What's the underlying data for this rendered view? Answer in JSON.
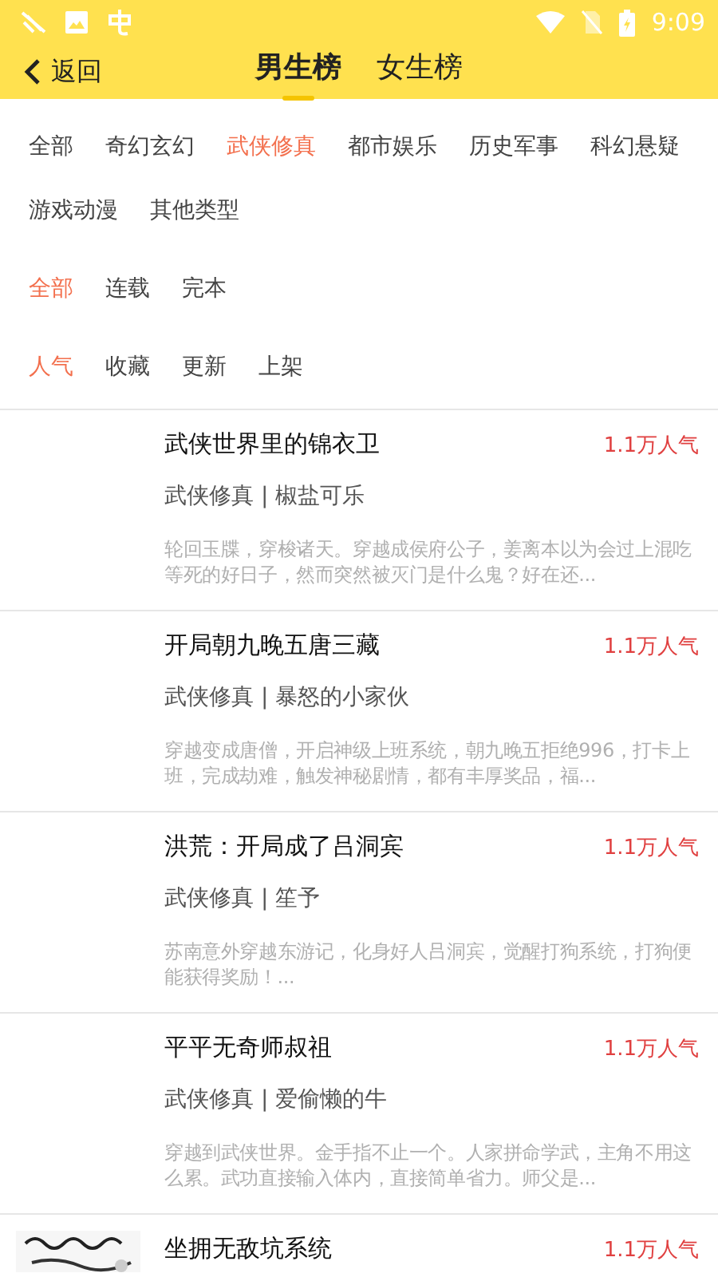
{
  "status_bar": {
    "time": "9:09"
  },
  "header": {
    "back": "返回",
    "tabs": [
      {
        "label": "男生榜",
        "selected": true
      },
      {
        "label": "女生榜",
        "selected": false
      }
    ]
  },
  "filters": [
    {
      "options": [
        {
          "label": "全部",
          "selected": false
        },
        {
          "label": "奇幻玄幻",
          "selected": false
        },
        {
          "label": "武侠修真",
          "selected": true
        },
        {
          "label": "都市娱乐",
          "selected": false
        },
        {
          "label": "历史军事",
          "selected": false
        },
        {
          "label": "科幻悬疑",
          "selected": false
        },
        {
          "label": "游戏动漫",
          "selected": false
        },
        {
          "label": "其他类型",
          "selected": false
        }
      ]
    },
    {
      "options": [
        {
          "label": "全部",
          "selected": true
        },
        {
          "label": "连载",
          "selected": false
        },
        {
          "label": "完本",
          "selected": false
        }
      ]
    },
    {
      "options": [
        {
          "label": "人气",
          "selected": true
        },
        {
          "label": "收藏",
          "selected": false
        },
        {
          "label": "更新",
          "selected": false
        },
        {
          "label": "上架",
          "selected": false
        }
      ]
    }
  ],
  "books": [
    {
      "title": "武侠世界里的锦衣卫",
      "popularity": "1.1万人气",
      "meta": "武侠修真 | 椒盐可乐",
      "summary": "轮回玉牒，穿梭诸天。穿越成侯府公子，姜离本以为会过上混吃等死的好日子，然而突然被灭门是什么鬼？好在还...",
      "cover_loaded": false
    },
    {
      "title": "开局朝九晚五唐三藏",
      "popularity": "1.1万人气",
      "meta": "武侠修真 | 暴怒的小家伙",
      "summary": "穿越变成唐僧，开启神级上班系统，朝九晚五拒绝996，打卡上班，完成劫难，触发神秘剧情，都有丰厚奖品，福...",
      "cover_loaded": false
    },
    {
      "title": "洪荒：开局成了吕洞宾",
      "popularity": "1.1万人气",
      "meta": "武侠修真 | 笙予",
      "summary": "苏南意外穿越东游记，化身好人吕洞宾，觉醒打狗系统，打狗便能获得奖励！...",
      "cover_loaded": false
    },
    {
      "title": "平平无奇师叔祖",
      "popularity": "1.1万人气",
      "meta": "武侠修真 | 爱偷懒的牛",
      "summary": "穿越到武侠世界。金手指不止一个。人家拼命学武，主角不用这么累。武功直接输入体内，直接简单省力。师父是...",
      "cover_loaded": false
    },
    {
      "title": "坐拥无敌坑系统",
      "popularity": "1.1万人气",
      "cover_loaded": true
    }
  ]
}
